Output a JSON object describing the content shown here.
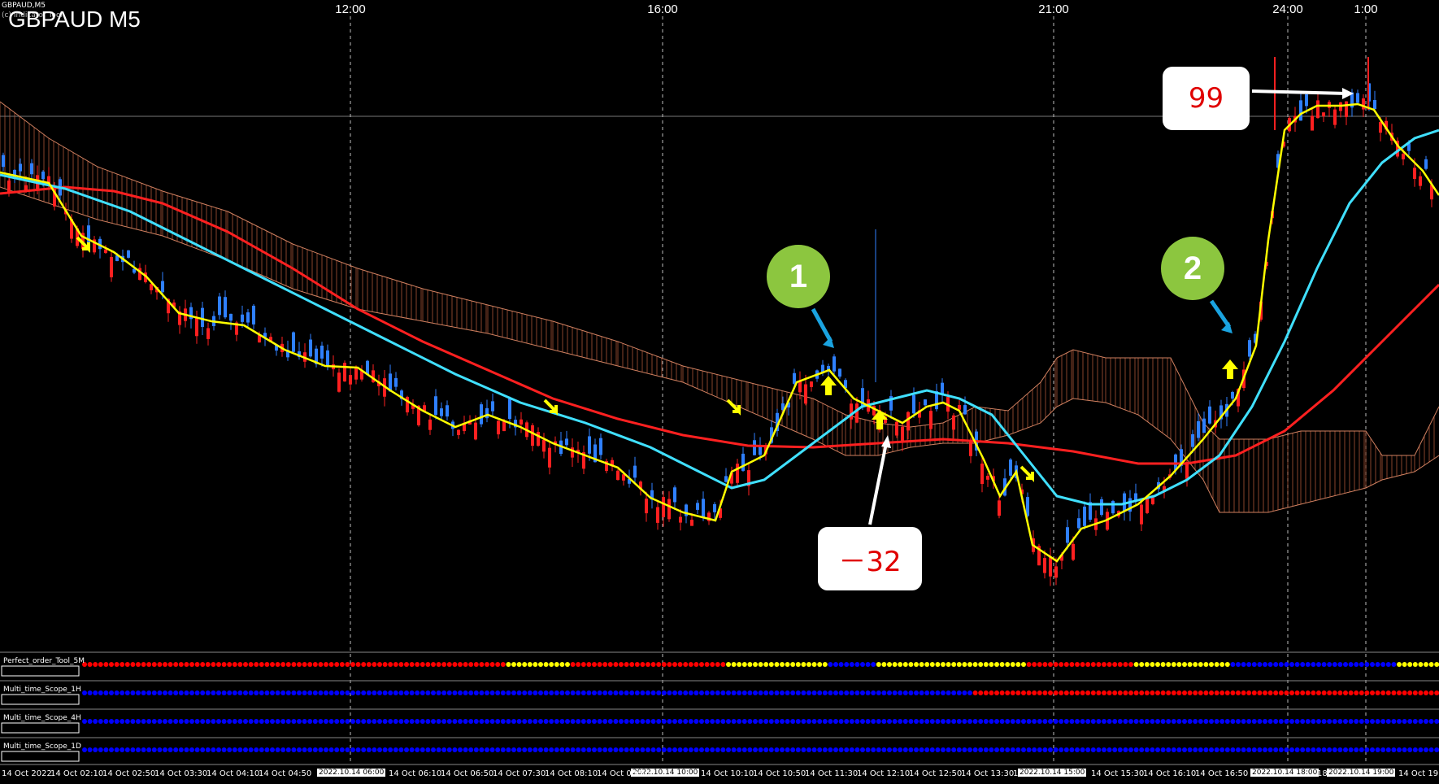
{
  "window": {
    "symbol_small": "GBPAUD,M5",
    "symbol_small2": "(c) Indicator Tool",
    "title": "GBPAUD M5"
  },
  "top_time_labels": [
    "12:00",
    "16:00",
    "21:00",
    "24:00",
    "1:00"
  ],
  "bottom_time_labels": [
    "14 Oct 2022",
    "14 Oct 02:10",
    "14 Oct 02:50",
    "14 Oct 03:30",
    "14 Oct 04:10",
    "14 Oct 04:50",
    "14 Oct 06:10",
    "14 Oct 06:50",
    "14 Oct 07:30",
    "14 Oct 08:10",
    "14 Oct 08:50",
    "14 Oct 10:10",
    "14 Oct 10:50",
    "14 Oct 11:30",
    "14 Oct 12:10",
    "14 Oct 12:50",
    "14 Oct 13:30",
    "14 Oct 14:",
    "14 Oct 15:30",
    "14 Oct 16:10",
    "14 Oct 16:50",
    "18",
    "14 Oct 19:"
  ],
  "bottom_highlight_labels": [
    "2022.10.14 06:00",
    "2022.10.14 10:00",
    "2022.10.14 15:00",
    "2022.10.14 18:00",
    "2022.10.14 19:00"
  ],
  "indicators": [
    {
      "name": "Perfect_order_Tool_5M",
      "colors": "#ff0000,#ffff00,#0000ff"
    },
    {
      "name": "Multi_time_Scope_1H",
      "colors": "#0000ff,#ff0000"
    },
    {
      "name": "Multi_time_Scope_4H",
      "colors": "#0000ff"
    },
    {
      "name": "Multi_time_Scope_1D",
      "colors": "#0000ff"
    }
  ],
  "annotations": {
    "badge1": "1",
    "badge2": "2",
    "callout_loss": "－32",
    "callout_gain": "99"
  },
  "colors": {
    "bull": "#2f80ff",
    "bear": "#ff2020",
    "ma_fast": "#ffff00",
    "ma_mid": "#40e0ff",
    "ma_slow": "#ff2020",
    "cloud": "#c06040",
    "badge": "#8cc63f",
    "pointer": "#1aa3e0"
  }
}
